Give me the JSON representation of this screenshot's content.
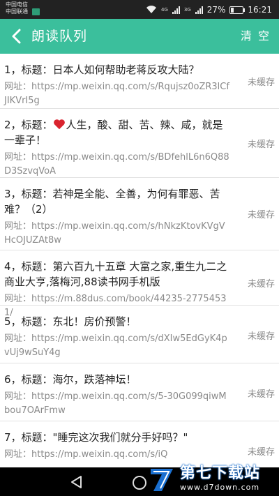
{
  "status_bar": {
    "carrier_1": "中国电信",
    "carrier_2": "中国联通",
    "network_1": "4G",
    "network_2": "3G",
    "battery": "27%",
    "time": "16:21"
  },
  "header": {
    "title": "朗读队列",
    "clear_label": "清 空"
  },
  "queue": [
    {
      "title": "1，标题：日本人如何帮助老蒋反攻大陆？",
      "url_prefix": "网址：",
      "url": "https://mp.weixin.qq.com/s/Rqujsz0oZR3lCfJIKVrI5g",
      "status": "未缓存"
    },
    {
      "title_prefix": "2，标题：",
      "title_rest": "人生，酸、甜、苦、辣、咸，就是一辈子！",
      "url_prefix": "网址：",
      "url": "https://mp.weixin.qq.com/s/BDfehlL6n6Q88D3SzvqVoA",
      "status": "未缓存"
    },
    {
      "title": "3，标题：若神是全能、全善，为何有罪恶、苦难？（2）",
      "url_prefix": "网址：",
      "url": "https://mp.weixin.qq.com/s/hNkzKtovKVgVHcOJUZAt8w",
      "status": "未缓存"
    },
    {
      "title": "4，标题：第六百九十五章 大富之家,重生九二之商业大亨,落梅河,88读书网手机版",
      "url_prefix": "网址：",
      "url": "https://m.88dus.com/book/44235-27754531/",
      "status": "未缓存"
    },
    {
      "title": "5，标题：东北！房价预警！",
      "url_prefix": "网址：",
      "url": "https://mp.weixin.qq.com/s/dXIw5EdGyK4pvUj9wSuY4g",
      "status": "未缓存"
    },
    {
      "title": "6，标题：海尔，跌落神坛！",
      "url_prefix": "网址：",
      "url": "https://mp.weixin.qq.com/s/5-30G099qiwMbou7OArFmw",
      "status": "未缓存"
    },
    {
      "title": "7，标题：\"睡完这次我们就分手好吗？\"",
      "url_prefix": "网址：",
      "url": "https://mp.weixin.qq.com/s/iQ",
      "status": "未缓存"
    }
  ],
  "watermark": {
    "name": "第七下载站",
    "url": "www.d7down.com"
  },
  "icons": {
    "back": "chevron-left-icon",
    "heart": "heart-icon",
    "nav_back": "triangle-back-icon",
    "nav_home": "circle-home-icon"
  },
  "colors": {
    "accent": "#3bbf9c",
    "status_bar": "#222222",
    "nav_bar": "#000000",
    "heart": "#d9232e"
  },
  "battery_level": 0.27
}
